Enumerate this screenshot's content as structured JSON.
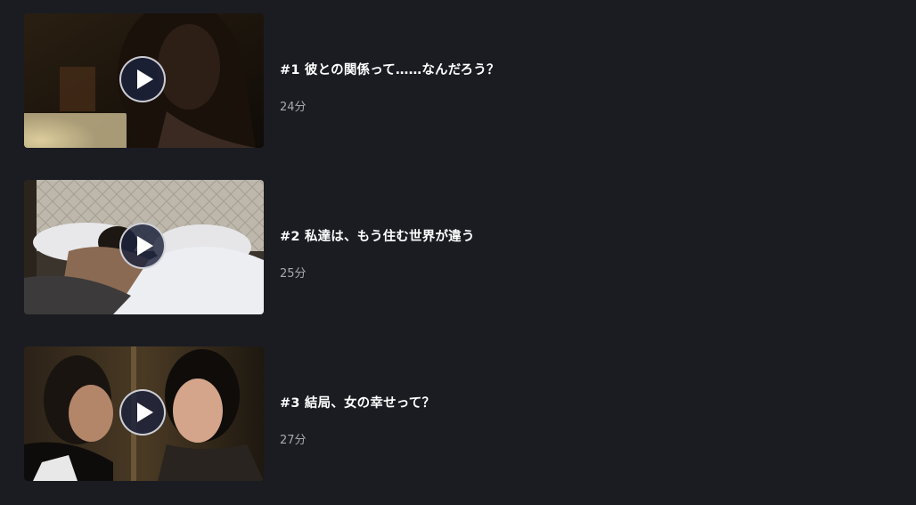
{
  "episodes": [
    {
      "title": "#1 彼との関係って……なんだろう？",
      "duration": "24分"
    },
    {
      "title": "#2 私達は、もう住む世界が違う",
      "duration": "25分"
    },
    {
      "title": "#3 結局、女の幸せって？",
      "duration": "27分"
    }
  ],
  "icons": {
    "play": "play-icon"
  },
  "colors": {
    "background": "#1b1c22",
    "title": "#ffffff",
    "duration": "#a8a9ae"
  }
}
